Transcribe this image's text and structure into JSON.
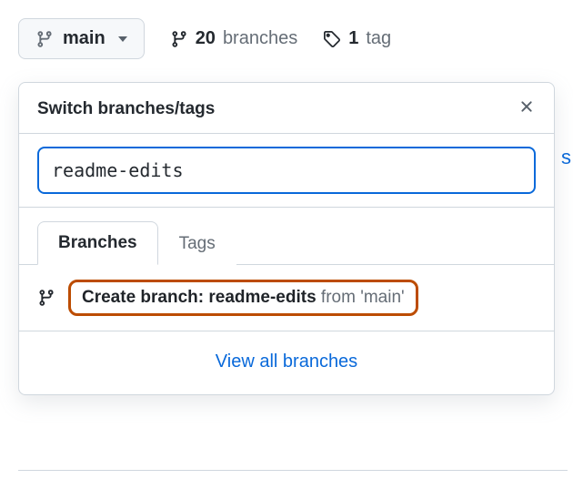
{
  "top": {
    "branch_btn_label": "main",
    "branches_count": "20",
    "branches_label": "branches",
    "tags_count": "1",
    "tags_label": "tag"
  },
  "popup": {
    "title": "Switch branches/tags",
    "search_value": "readme-edits",
    "tabs": {
      "branches": "Branches",
      "tags": "Tags"
    },
    "create": {
      "prefix": "Create branch: ",
      "name": "readme-edits",
      "suffix": " from 'main'"
    },
    "footer": "View all branches"
  },
  "bg_hint": "s"
}
